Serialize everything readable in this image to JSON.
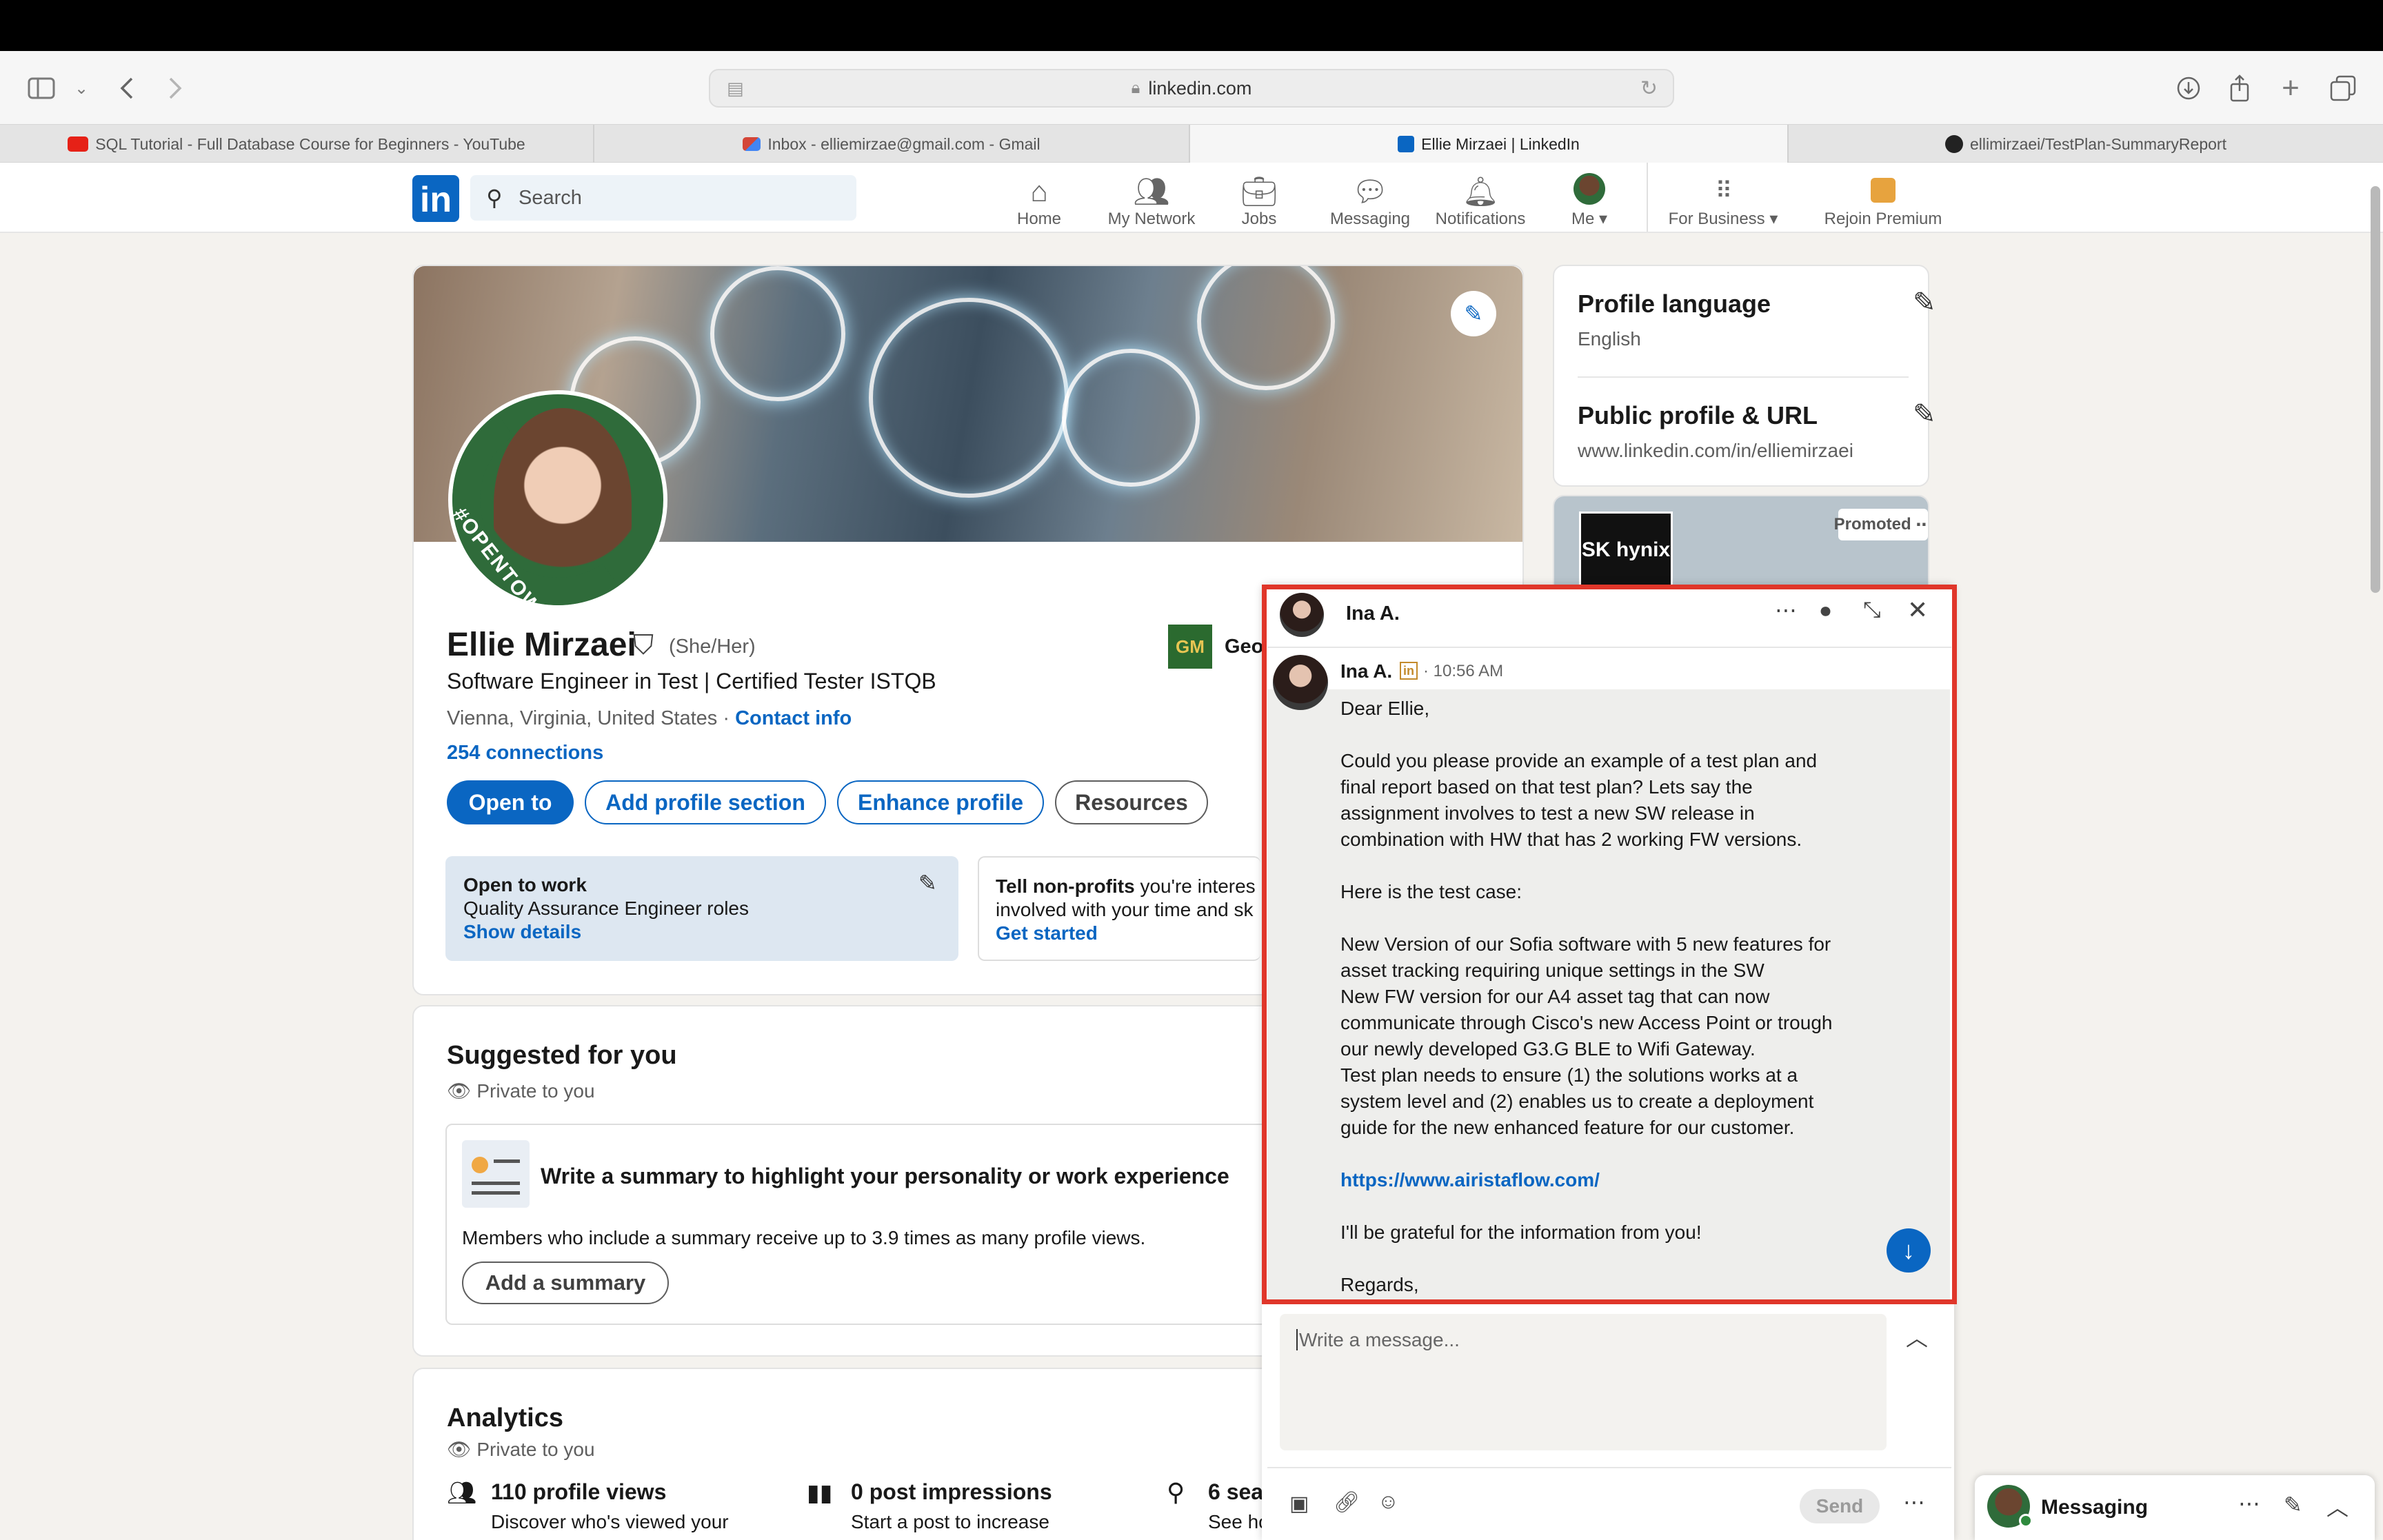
{
  "browser": {
    "url": "linkedin.com",
    "tabs": [
      {
        "label": "SQL Tutorial - Full Database Course for Beginners - YouTube",
        "icon": "youtube-icon",
        "color": "#e62117"
      },
      {
        "label": "Inbox - elliemirzae@gmail.com - Gmail",
        "icon": "gmail-icon",
        "color": "#d44638"
      },
      {
        "label": "Ellie Mirzaei | LinkedIn",
        "icon": "linkedin-icon",
        "color": "#0a66c2"
      },
      {
        "label": "ellimirzaei/TestPlan-SummaryReport",
        "icon": "github-icon",
        "color": "#222222"
      }
    ]
  },
  "header": {
    "search_placeholder": "Search",
    "nav": [
      {
        "label": "Home",
        "icon": "home-icon"
      },
      {
        "label": "My Network",
        "icon": "network-icon"
      },
      {
        "label": "Jobs",
        "icon": "jobs-icon"
      },
      {
        "label": "Messaging",
        "icon": "messaging-icon"
      },
      {
        "label": "Notifications",
        "icon": "bell-icon"
      },
      {
        "label": "Me",
        "icon": "avatar"
      },
      {
        "label": "For Business",
        "icon": "grid-icon"
      },
      {
        "label": "Rejoin Premium",
        "icon": "premium-icon"
      }
    ]
  },
  "profile": {
    "name": "Ellie Mirzaei",
    "pronouns": "(She/Her)",
    "headline": "Software Engineer in Test | Certified Tester ISTQB",
    "location": "Vienna, Virginia, United States",
    "separator": "·",
    "contact_info": "Contact info",
    "connections": "254 connections",
    "opentowork_frame": "#OPENTOWORK",
    "company_partial": "Geo",
    "company_logo_text": "GM",
    "buttons": {
      "open_to": "Open to",
      "add_section": "Add profile section",
      "enhance": "Enhance profile",
      "resources": "Resources"
    },
    "open_to_work": {
      "title": "Open to work",
      "roles": "Quality Assurance Engineer roles",
      "link": "Show details"
    },
    "nonprofits": {
      "title_bold": "Tell non-profits",
      "title_rest": " you're interes",
      "line2": "involved with your time and sk",
      "link": "Get started"
    }
  },
  "suggested": {
    "title": "Suggested for you",
    "privacy": "Private to you",
    "card_title": "Write a summary to highlight your personality or work experience",
    "card_body": "Members who include a summary receive up to 3.9 times as many profile views.",
    "button": "Add a summary"
  },
  "analytics": {
    "title": "Analytics",
    "privacy": "Private to you",
    "items": [
      {
        "value": "110 profile views",
        "sub": "Discover who's viewed your"
      },
      {
        "value": "0 post impressions",
        "sub": "Start a post to increase"
      },
      {
        "value": "6 sea",
        "sub": "See ho"
      }
    ]
  },
  "sidebar": {
    "profile_language": {
      "title": "Profile language",
      "value": "English"
    },
    "public_profile": {
      "title": "Public profile & URL",
      "value": "www.linkedin.com/in/elliemirzaei"
    },
    "promoted_label": "Promoted",
    "ad_logo": "SK hynix"
  },
  "chat": {
    "contact": "Ina A.",
    "sender": "Ina A.",
    "time": "· 10:56 AM",
    "message_lines": [
      "Dear Ellie,",
      "",
      "Could you please provide an example of a test plan and",
      "final report based on that test plan? Lets say the",
      "assignment involves to test a new SW release in",
      "combination with HW that has 2 working FW versions.",
      "",
      "Here is the test case:",
      "",
      "New Version of our Sofia software with 5 new features for",
      "asset tracking requiring unique settings in the SW",
      "New FW version for our A4 asset tag that can now",
      "communicate through Cisco's new Access Point or trough",
      "our newly developed G3.G BLE to Wifi Gateway.",
      "Test plan needs to ensure (1) the solutions works at a",
      "system level and (2) enables us to create a deployment",
      "guide for the new enhanced feature for our customer.",
      ""
    ],
    "link": "https://www.airistaflow.com/",
    "closing": "I'll be grateful for the information from you!",
    "signoff": "Regards,",
    "input_placeholder": "Write a message...",
    "send": "Send",
    "highlight_color": "#e0362a"
  },
  "dock": {
    "label": "Messaging"
  }
}
